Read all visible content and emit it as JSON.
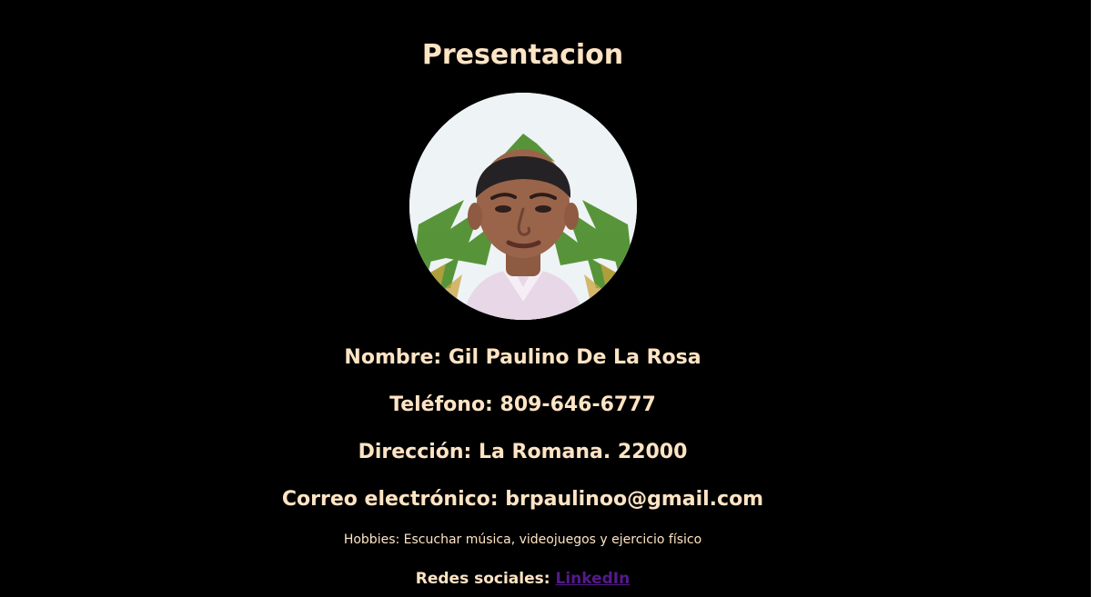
{
  "page": {
    "title": "Presentacion",
    "avatar_alt": "Foto de perfil",
    "background_color": "#000000",
    "text_color": "#ffe4c4",
    "link_color": "#551a8b"
  },
  "info": {
    "nombre": "Nombre: Gil Paulino De La Rosa",
    "telefono": "Teléfono: 809-646-6777",
    "direccion": "Dirección: La Romana. 22000",
    "correo": "Correo electrónico: brpaulinoo@gmail.com",
    "hobbies": "Hobbies: Escuchar música, videojuegos y ejercicio físico"
  },
  "social": {
    "label": "Redes sociales:",
    "link_text": "LinkedIn"
  }
}
